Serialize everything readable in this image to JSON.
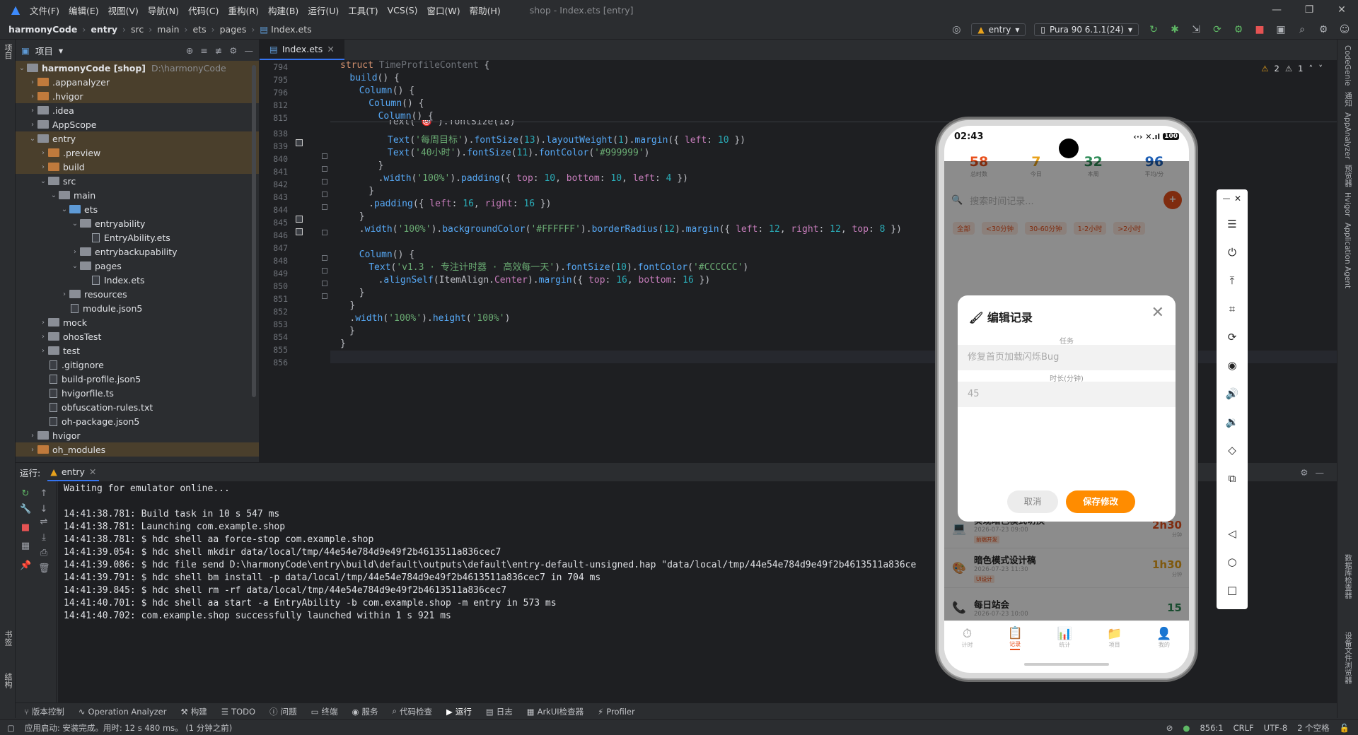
{
  "menubar": {
    "items": [
      "文件(F)",
      "编辑(E)",
      "视图(V)",
      "导航(N)",
      "代码(C)",
      "重构(R)",
      "构建(B)",
      "运行(U)",
      "工具(T)",
      "VCS(S)",
      "窗口(W)",
      "帮助(H)"
    ],
    "window_title": "shop - Index.ets [entry]"
  },
  "breadcrumb": [
    "harmonyCode",
    "entry",
    "src",
    "main",
    "ets",
    "pages",
    "Index.ets"
  ],
  "toolbar": {
    "module": "entry",
    "device": "Pura 90 6.1.1(24)"
  },
  "left_strip": {
    "project": "项目",
    "bookmarks": "书签",
    "structure": "结构"
  },
  "project": {
    "title": "项目",
    "tree": [
      {
        "name": "harmonyCode [shop]",
        "path": "D:\\harmonyCode",
        "d": 0,
        "arrow": "v",
        "type": "folder",
        "hl": true
      },
      {
        "name": ".appanalyzer",
        "d": 1,
        "arrow": ">",
        "type": "folder-orange",
        "hl": true
      },
      {
        "name": ".hvigor",
        "d": 1,
        "arrow": ">",
        "type": "folder-orange",
        "hl": true
      },
      {
        "name": ".idea",
        "d": 1,
        "arrow": ">",
        "type": "folder"
      },
      {
        "name": "AppScope",
        "d": 1,
        "arrow": ">",
        "type": "folder"
      },
      {
        "name": "entry",
        "d": 1,
        "arrow": "v",
        "type": "folder",
        "hl": true
      },
      {
        "name": ".preview",
        "d": 2,
        "arrow": ">",
        "type": "folder-orange",
        "hl": true
      },
      {
        "name": "build",
        "d": 2,
        "arrow": ">",
        "type": "folder-orange",
        "hl": true
      },
      {
        "name": "src",
        "d": 2,
        "arrow": "v",
        "type": "folder"
      },
      {
        "name": "main",
        "d": 3,
        "arrow": "v",
        "type": "folder"
      },
      {
        "name": "ets",
        "d": 4,
        "arrow": "v",
        "type": "folder-blue"
      },
      {
        "name": "entryability",
        "d": 5,
        "arrow": "v",
        "type": "folder"
      },
      {
        "name": "EntryAbility.ets",
        "d": 6,
        "arrow": "",
        "type": "file"
      },
      {
        "name": "entrybackupability",
        "d": 5,
        "arrow": ">",
        "type": "folder"
      },
      {
        "name": "pages",
        "d": 5,
        "arrow": "v",
        "type": "folder"
      },
      {
        "name": "Index.ets",
        "d": 6,
        "arrow": "",
        "type": "file"
      },
      {
        "name": "resources",
        "d": 4,
        "arrow": ">",
        "type": "folder"
      },
      {
        "name": "module.json5",
        "d": 4,
        "arrow": "",
        "type": "file"
      },
      {
        "name": "mock",
        "d": 2,
        "arrow": ">",
        "type": "folder"
      },
      {
        "name": "ohosTest",
        "d": 2,
        "arrow": ">",
        "type": "folder"
      },
      {
        "name": "test",
        "d": 2,
        "arrow": ">",
        "type": "folder"
      },
      {
        "name": ".gitignore",
        "d": 2,
        "arrow": "",
        "type": "file"
      },
      {
        "name": "build-profile.json5",
        "d": 2,
        "arrow": "",
        "type": "file"
      },
      {
        "name": "hvigorfile.ts",
        "d": 2,
        "arrow": "",
        "type": "file"
      },
      {
        "name": "obfuscation-rules.txt",
        "d": 2,
        "arrow": "",
        "type": "file"
      },
      {
        "name": "oh-package.json5",
        "d": 2,
        "arrow": "",
        "type": "file"
      },
      {
        "name": "hvigor",
        "d": 1,
        "arrow": ">",
        "type": "folder"
      },
      {
        "name": "oh_modules",
        "d": 1,
        "arrow": ">",
        "type": "folder-orange",
        "hl": true
      }
    ]
  },
  "editor": {
    "tab": "Index.ets",
    "warnings": "2",
    "weak_warnings": "1",
    "sticky_numbers": [
      "794",
      "795",
      "796",
      "812",
      "815"
    ],
    "line_numbers": [
      "838",
      "839",
      "840",
      "841",
      "842",
      "843",
      "844",
      "845",
      "846",
      "847",
      "848",
      "849",
      "850",
      "851",
      "852",
      "853",
      "854",
      "855",
      "856"
    ],
    "code": {
      "s794_kw": "struct ",
      "s794_ty": "TimeProfileContent",
      "s794_p": " {",
      "s795_fn": "build",
      "s795_p": "() {",
      "s796_fn": "Column",
      "s796_p": "() {",
      "s812_fn": "Column",
      "s812_p": "() {",
      "s815_fn": "Column",
      "s815_p": "() {",
      "l838_a": "Text(",
      "l838_b": "'🎯'",
      "l838_c": ").fontSize(18)",
      "l839_fn": "Text",
      "l839_a": "(",
      "l839_s": "'每周目标'",
      "l839_b": ").",
      "l839_m1": "fontSize",
      "l839_c": "(",
      "l839_n1": "13",
      "l839_d": ").",
      "l839_m2": "layoutWeight",
      "l839_e": "(",
      "l839_n2": "1",
      "l839_f": ").",
      "l839_m3": "margin",
      "l839_g": "({ ",
      "l839_k": "left",
      "l839_h": ": ",
      "l839_n3": "10",
      "l839_i": " })",
      "l840_fn": "Text",
      "l840_a": "(",
      "l840_s": "'40小时'",
      "l840_b": ").",
      "l840_m1": "fontSize",
      "l840_c": "(",
      "l840_n1": "11",
      "l840_d": ").",
      "l840_m2": "fontColor",
      "l840_e": "(",
      "l840_s2": "'#999999'",
      "l840_f": ")",
      "l841": "}",
      "l842_a": ".",
      "l842_m1": "width",
      "l842_b": "(",
      "l842_s": "'100%'",
      "l842_c": ").",
      "l842_m2": "padding",
      "l842_d": "({ ",
      "l842_k1": "top",
      "l842_e": ": ",
      "l842_n1": "10",
      "l842_f": ", ",
      "l842_k2": "bottom",
      "l842_g": ": ",
      "l842_n2": "10",
      "l842_h": ", ",
      "l842_k3": "left",
      "l842_i": ": ",
      "l842_n3": "4",
      "l842_j": " })",
      "l843": "}",
      "l844_a": ".",
      "l844_m": "padding",
      "l844_b": "({ ",
      "l844_k1": "left",
      "l844_c": ": ",
      "l844_n1": "16",
      "l844_d": ", ",
      "l844_k2": "right",
      "l844_e": ": ",
      "l844_n2": "16",
      "l844_f": " })",
      "l845": "}",
      "l846_a": ".",
      "l846_m1": "width",
      "l846_b": "(",
      "l846_s1": "'100%'",
      "l846_c": ").",
      "l846_m2": "backgroundColor",
      "l846_d": "(",
      "l846_s2": "'#FFFFFF'",
      "l846_e": ").",
      "l846_m3": "borderRadius",
      "l846_f": "(",
      "l846_n1": "12",
      "l846_g": ").",
      "l846_m4": "margin",
      "l846_h": "({ ",
      "l846_k1": "left",
      "l846_i": ": ",
      "l846_n2": "12",
      "l846_j": ", ",
      "l846_k2": "right",
      "l846_k": ": ",
      "l846_n3": "12",
      "l846_l": ", ",
      "l846_k3": "top",
      "l846_m": ": ",
      "l846_n4": "8",
      "l846_o": " })",
      "l848_fn": "Column",
      "l848_p": "() {",
      "l849_fn": "Text",
      "l849_a": "(",
      "l849_s": "'v1.3 · 专注计时器 · 高效每一天'",
      "l849_b": ").",
      "l849_m1": "fontSize",
      "l849_c": "(",
      "l849_n1": "10",
      "l849_d": ").",
      "l849_m2": "fontColor",
      "l849_e": "(",
      "l849_s2": "'#CCCCCC'",
      "l849_f": ")",
      "l850_a": ".",
      "l850_m1": "alignSelf",
      "l850_b": "(ItemAlign.",
      "l850_e": "Center",
      "l850_c": ").",
      "l850_m2": "margin",
      "l850_d": "({ ",
      "l850_k1": "top",
      "l850_f": ": ",
      "l850_n1": "16",
      "l850_g": ", ",
      "l850_k2": "bottom",
      "l850_h": ": ",
      "l850_n2": "16",
      "l850_i": " })",
      "l851": "}",
      "l852": "}",
      "l853_a": ".",
      "l853_m1": "width",
      "l853_b": "(",
      "l853_s1": "'100%'",
      "l853_c": ").",
      "l853_m2": "height",
      "l853_d": "(",
      "l853_s2": "'100%'",
      "l853_e": ")",
      "l854": "}",
      "l855": "}"
    }
  },
  "run": {
    "label": "运行:",
    "tab": "entry",
    "lines": [
      "Waiting for emulator online...",
      "",
      "14:41:38.781: Build task in 10 s 547 ms",
      "14:41:38.781: Launching com.example.shop",
      "14:41:38.781: $ hdc shell aa force-stop com.example.shop",
      "14:41:39.054: $ hdc shell mkdir data/local/tmp/44e54e784d9e49f2b4613511a836cec7",
      "14:41:39.086: $ hdc file send D:\\harmonyCode\\entry\\build\\default\\outputs\\default\\entry-default-unsigned.hap \"data/local/tmp/44e54e784d9e49f2b4613511a836ce",
      "14:41:39.791: $ hdc shell bm install -p data/local/tmp/44e54e784d9e49f2b4613511a836cec7 in 704 ms",
      "14:41:39.845: $ hdc shell rm -rf data/local/tmp/44e54e784d9e49f2b4613511a836cec7",
      "14:41:40.701: $ hdc shell aa start -a EntryAbility -b com.example.shop -m entry in 573 ms",
      "14:41:40.702: com.example.shop successfully launched within 1 s 921 ms"
    ]
  },
  "bottom_tabs": [
    "版本控制",
    "Operation Analyzer",
    "构建",
    "TODO",
    "问题",
    "终端",
    "服务",
    "代码检查",
    "运行",
    "日志",
    "ArkUI检查器",
    "Profiler"
  ],
  "status": {
    "message": "应用启动: 安装完成。用时: 12 s 480 ms。 (1 分钟之前)",
    "position": "856:1",
    "line_sep": "CRLF",
    "encoding": "UTF-8",
    "indent": "2 个空格"
  },
  "right_strip": [
    "CodeGenie",
    "通知",
    "AppAnalyzer",
    "预览器",
    "Hvigor",
    "Application Agent",
    "数据库检查器",
    "设备文件浏览器"
  ],
  "phone": {
    "time": "02:43",
    "battery": "100",
    "stats": [
      {
        "value": "58",
        "label": "总时数",
        "color": "#e8501c"
      },
      {
        "value": "7",
        "label": "今日",
        "color": "#e8a21c"
      },
      {
        "value": "32",
        "label": "本周",
        "color": "#2e8b57"
      },
      {
        "value": "96",
        "label": "平均/分",
        "color": "#1e5fb4"
      }
    ],
    "search_placeholder": "搜索时间记录...",
    "chips": [
      "全部",
      "<30分钟",
      "30-60分钟",
      "1-2小时",
      ">2小时"
    ],
    "dialog": {
      "title": "编辑记录",
      "task_label": "任务",
      "task_value": "修复首页加载闪烁Bug",
      "duration_label": "时长(分钟)",
      "duration_value": "45",
      "cancel": "取消",
      "save": "保存修改"
    },
    "items": [
      {
        "icon": "💻",
        "title": "实现暗色模式切换",
        "time": "2026-07-23 09:00",
        "tag": "前端开发",
        "dur": "2h30",
        "unit": "分钟",
        "color": "#e8501c"
      },
      {
        "icon": "🎨",
        "title": "暗色模式设计稿",
        "time": "2026-07-23 11:30",
        "tag": "UI设计",
        "dur": "1h30",
        "unit": "分钟",
        "color": "#e8a21c"
      },
      {
        "icon": "📞",
        "title": "每日站会",
        "time": "2026-07-23 10:00",
        "tag": "",
        "dur": "15",
        "unit": "",
        "color": "#2e8b57"
      }
    ],
    "tabs": [
      {
        "icon": "⏱",
        "label": "计时"
      },
      {
        "icon": "📋",
        "label": "记录",
        "active": true
      },
      {
        "icon": "📊",
        "label": "统计"
      },
      {
        "icon": "📁",
        "label": "项目"
      },
      {
        "icon": "👤",
        "label": "我的"
      }
    ]
  },
  "colors": {
    "accent": "#3574f0",
    "orange": "#ff8c00",
    "brand_red": "#e8501c"
  }
}
